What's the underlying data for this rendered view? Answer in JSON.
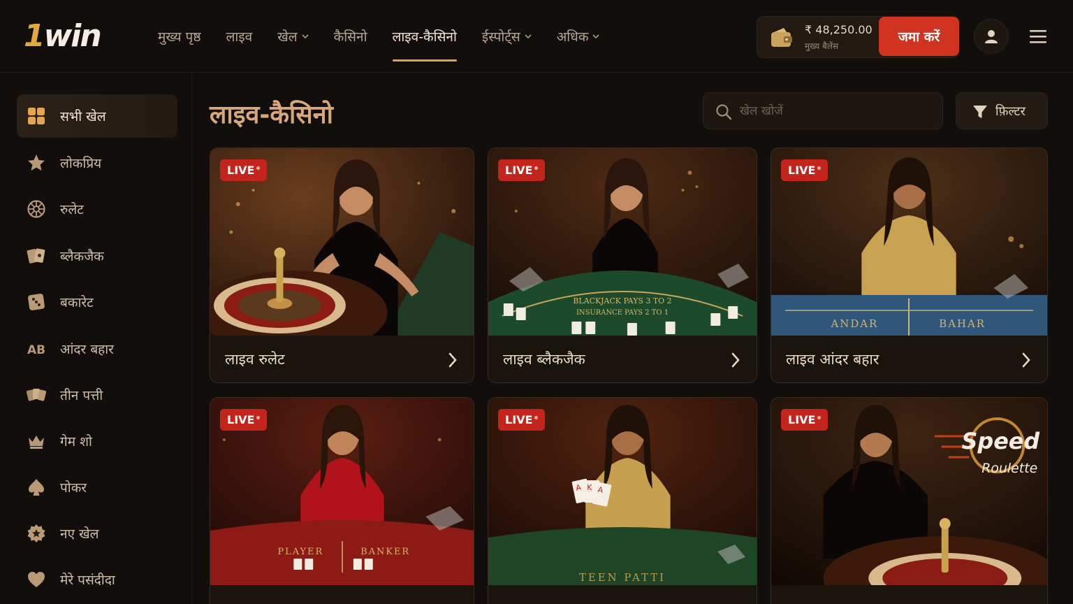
{
  "header": {
    "logo_one": "1",
    "logo_win": "win",
    "nav": [
      {
        "label": "मुख्य पृष्ठ",
        "dropdown": false,
        "active": false
      },
      {
        "label": "लाइव",
        "dropdown": false,
        "active": false
      },
      {
        "label": "खेल",
        "dropdown": true,
        "active": false
      },
      {
        "label": "कैसिनो",
        "dropdown": false,
        "active": false
      },
      {
        "label": "लाइव-कैसिनो",
        "dropdown": false,
        "active": true
      },
      {
        "label": "ईस्पोर्ट्स",
        "dropdown": true,
        "active": false
      },
      {
        "label": "अधिक",
        "dropdown": true,
        "active": false
      }
    ],
    "wallet": {
      "balance": "₹ 48,250.00",
      "label": "मुख्य बैलेंस",
      "icon": "wallet-icon"
    },
    "deposit_label": "जमा करें",
    "avatar_icon": "user-icon",
    "menu_icon": "hamburger-icon"
  },
  "sidebar": {
    "items": [
      {
        "label": "सभी खेल",
        "icon": "grid-icon",
        "active": true
      },
      {
        "label": "लोकप्रिय",
        "icon": "star-icon",
        "active": false
      },
      {
        "label": "रुलेट",
        "icon": "roulette-icon",
        "active": false
      },
      {
        "label": "ब्लैकजैक",
        "icon": "cards-icon",
        "active": false
      },
      {
        "label": "बकारेट",
        "icon": "dice-card-icon",
        "active": false
      },
      {
        "label": "आंदर बहार",
        "icon": "ab-icon",
        "active": false
      },
      {
        "label": "तीन पत्ती",
        "icon": "three-cards-icon",
        "active": false
      },
      {
        "label": "गेम शो",
        "icon": "crown-icon",
        "active": false
      },
      {
        "label": "पोकर",
        "icon": "spade-icon",
        "active": false
      },
      {
        "label": "नए खेल",
        "icon": "badge-star-icon",
        "active": false
      },
      {
        "label": "मेरे पसंदीदा",
        "icon": "heart-icon",
        "active": false
      }
    ]
  },
  "main": {
    "title": "लाइव-कैसिनो",
    "search_placeholder": "खेल खोजें",
    "filter_label": "फ़िल्टर",
    "live_label": "LIVE",
    "cards": [
      {
        "title": "लाइव रुलेट",
        "table_text": []
      },
      {
        "title": "लाइव ब्लैकजैक",
        "table_text": [
          "BLACKJACK PAYS 3 TO 2",
          "INSURANCE PAYS 2 TO 1"
        ]
      },
      {
        "title": "लाइव आंदर बहार",
        "table_text": [
          "ANDAR",
          "BAHAR"
        ]
      },
      {
        "title": "",
        "table_text": [
          "PLAYER",
          "BANKER"
        ]
      },
      {
        "title": "",
        "table_text": [
          "TEEN PATTI"
        ]
      },
      {
        "title": "",
        "table_text": [],
        "logo_text": [
          "Speed",
          "Roulette"
        ]
      }
    ]
  },
  "colors": {
    "background": "#120e0b",
    "accent": "#e0a05a",
    "deposit": "#d0331f",
    "live_badge": "#c3241b",
    "title": "#d8a87a"
  }
}
